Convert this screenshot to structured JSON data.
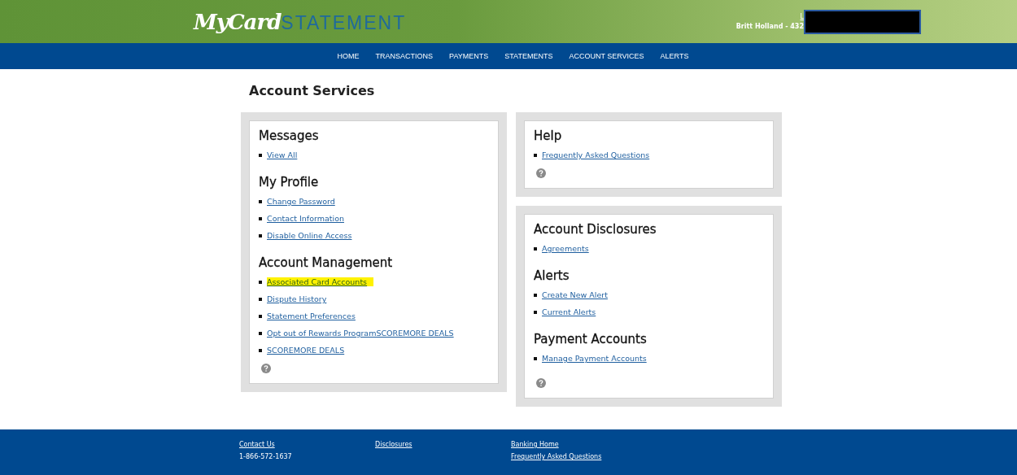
{
  "header": {
    "logo_script": "MyCard",
    "logo_word": "STATEMENT",
    "user_link": "L",
    "user_name": "Britt Holland - 432",
    "redacted": true
  },
  "nav": [
    {
      "label": "HOME",
      "selected": false
    },
    {
      "label": "TRANSACTIONS",
      "selected": false
    },
    {
      "label": "PAYMENTS",
      "selected": false
    },
    {
      "label": "STATEMENTS",
      "selected": false
    },
    {
      "label": "ACCOUNT SERVICES",
      "selected": false
    },
    {
      "label": "ALERTS",
      "selected": false
    }
  ],
  "page_title": "Account Services",
  "columns": [
    {
      "panels": [
        {
          "help": true,
          "sections": [
            {
              "title": "Messages",
              "links": [
                {
                  "label": "View All",
                  "highlighted": false
                }
              ]
            },
            {
              "title": "My Profile",
              "links": [
                {
                  "label": "Change Password",
                  "highlighted": false
                },
                {
                  "label": "Contact Information",
                  "highlighted": false
                },
                {
                  "label": "Disable Online Access",
                  "highlighted": false
                }
              ]
            },
            {
              "title": "Account Management",
              "links": [
                {
                  "label": "Associated Card Accounts",
                  "highlighted": true
                },
                {
                  "label": "Dispute History",
                  "highlighted": false
                },
                {
                  "label": "Statement Preferences",
                  "highlighted": false
                },
                {
                  "label": "Opt out of Rewards ProgramSCOREMORE DEALS",
                  "highlighted": false
                },
                {
                  "label": "SCOREMORE DEALS",
                  "highlighted": false
                }
              ]
            }
          ]
        }
      ]
    },
    {
      "panels": [
        {
          "help": true,
          "sections": [
            {
              "title": "Help",
              "links": [
                {
                  "label": "Frequently Asked Questions",
                  "highlighted": false
                }
              ]
            }
          ]
        },
        {
          "help": true,
          "sections": [
            {
              "title": "Account Disclosures",
              "links": [
                {
                  "label": "Agreements",
                  "highlighted": false
                }
              ]
            },
            {
              "title": "Alerts",
              "links": [
                {
                  "label": "Create New Alert",
                  "highlighted": false
                },
                {
                  "label": "Current Alerts",
                  "highlighted": false
                }
              ]
            },
            {
              "title": "Payment Accounts",
              "links": [
                {
                  "label": "Manage Payment Accounts",
                  "highlighted": false
                }
              ]
            }
          ]
        }
      ]
    }
  ],
  "footer": [
    {
      "items": [
        {
          "kind": "link",
          "text": "Contact Us"
        },
        {
          "kind": "text",
          "text": "1-866-572-1637"
        }
      ]
    },
    {
      "items": [
        {
          "kind": "link",
          "text": "Disclosures"
        }
      ]
    },
    {
      "items": [
        {
          "kind": "link",
          "text": "Banking Home"
        },
        {
          "kind": "link",
          "text": "Frequently Asked Questions"
        }
      ]
    }
  ]
}
